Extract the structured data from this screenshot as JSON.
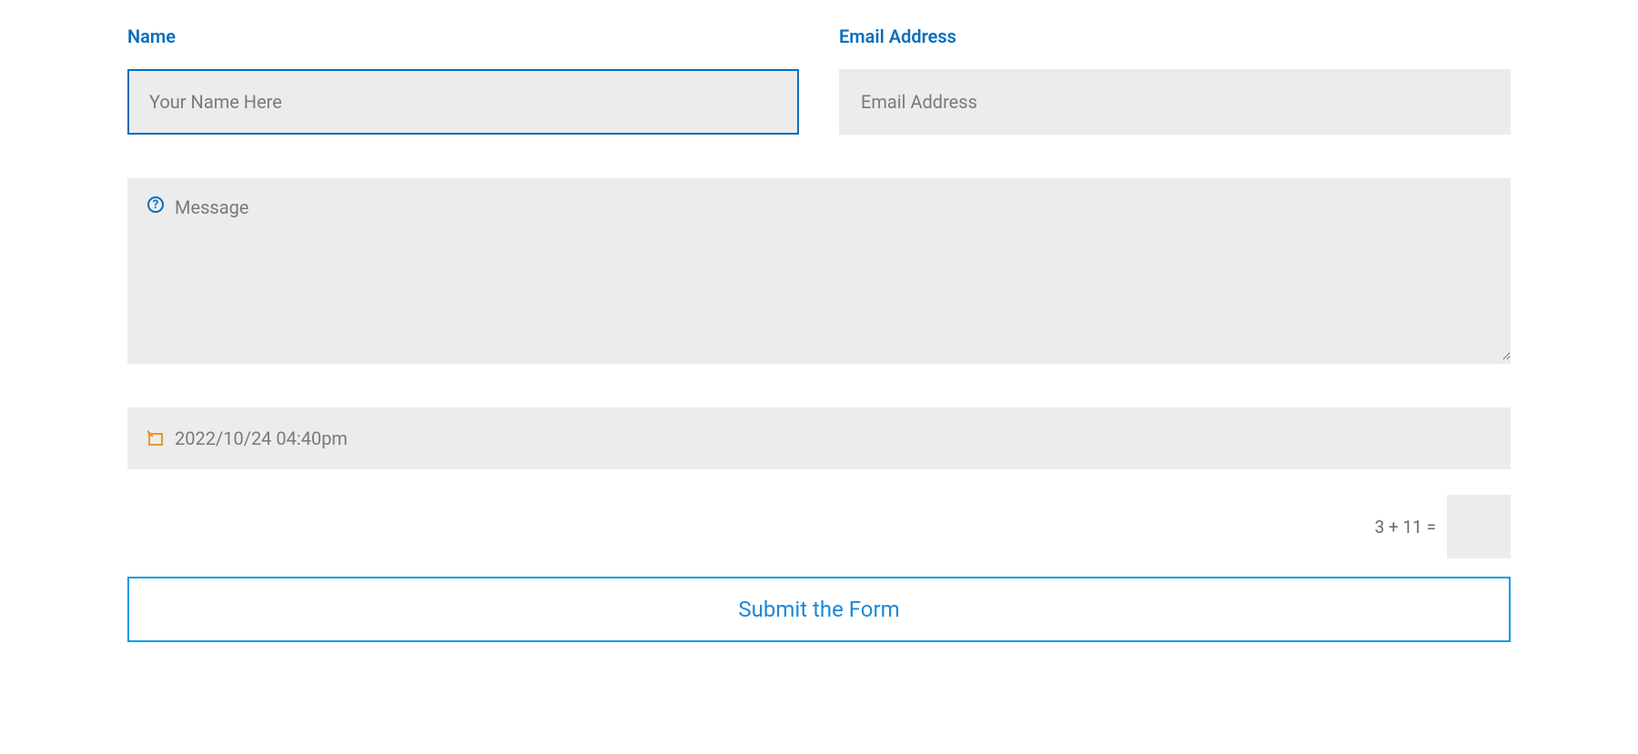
{
  "form": {
    "name": {
      "label": "Name",
      "placeholder": "Your Name Here",
      "value": ""
    },
    "email": {
      "label": "Email Address",
      "placeholder": "Email Address",
      "value": ""
    },
    "message": {
      "placeholder": "Message",
      "help_icon": "?"
    },
    "datetime": {
      "value": "2022/10/24 04:40pm",
      "icon": "calendar-icon"
    },
    "captcha": {
      "question": "3 + 11 =",
      "value": ""
    },
    "submit_label": "Submit the Form"
  },
  "colors": {
    "accent": "#0a6ebd",
    "input_bg": "#ececec",
    "calendar_icon": "#e19a2b"
  }
}
